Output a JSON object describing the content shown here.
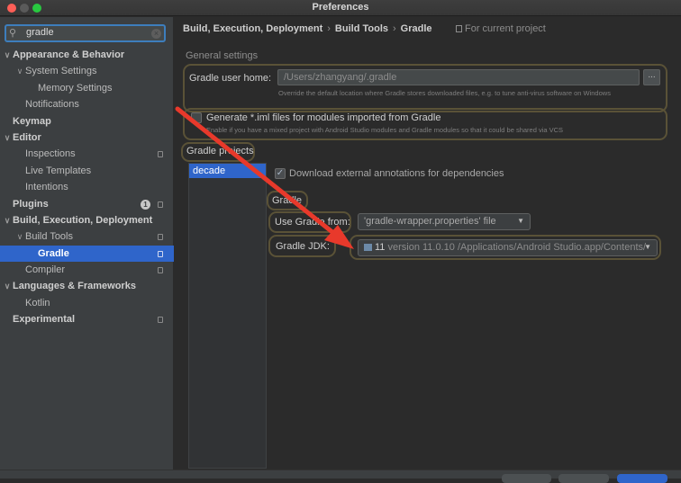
{
  "window": {
    "title": "Preferences"
  },
  "sidebar": {
    "search_value": "gradle",
    "items": [
      {
        "label": "Appearance & Behavior",
        "level": 0,
        "chevron": "down",
        "bold": true
      },
      {
        "label": "System Settings",
        "level": 1,
        "chevron": "down"
      },
      {
        "label": "Memory Settings",
        "level": 2
      },
      {
        "label": "Notifications",
        "level": 1
      },
      {
        "label": "Keymap",
        "level": 0,
        "bold": true
      },
      {
        "label": "Editor",
        "level": 0,
        "chevron": "down",
        "bold": true
      },
      {
        "label": "Inspections",
        "level": 1,
        "copy_icon": true
      },
      {
        "label": "Live Templates",
        "level": 1
      },
      {
        "label": "Intentions",
        "level": 1
      },
      {
        "label": "Plugins",
        "level": 0,
        "bold": true,
        "badge": "1",
        "copy_icon": true
      },
      {
        "label": "Build, Execution, Deployment",
        "level": 0,
        "chevron": "down",
        "bold": true
      },
      {
        "label": "Build Tools",
        "level": 1,
        "chevron": "down",
        "copy_icon": true
      },
      {
        "label": "Gradle",
        "level": 2,
        "selected": true,
        "bold": true,
        "copy_icon": true
      },
      {
        "label": "Compiler",
        "level": 1,
        "copy_icon": true
      },
      {
        "label": "Languages & Frameworks",
        "level": 0,
        "chevron": "down",
        "bold": true
      },
      {
        "label": "Kotlin",
        "level": 1
      },
      {
        "label": "Experimental",
        "level": 0,
        "bold": true,
        "copy_icon": true
      }
    ]
  },
  "breadcrumb": {
    "items": [
      "Build, Execution, Deployment",
      "Build Tools",
      "Gradle"
    ],
    "separator": "›",
    "scope_label": "For current project"
  },
  "general": {
    "section_title": "General settings",
    "user_home_label": "Gradle user home:",
    "user_home_value": "/Users/zhangyang/.gradle",
    "browse_label": "...",
    "user_home_hint": "Override the default location where Gradle stores downloaded files, e.g. to tune anti-virus software on Windows",
    "iml_checkbox_label": "Generate *.iml files for modules imported from Gradle",
    "iml_checked": false,
    "iml_hint": "Enable if you have a mixed project with Android Studio modules and Gradle modules so that it could be shared via VCS"
  },
  "projects": {
    "section_title": "Gradle projects",
    "list": [
      "decade"
    ],
    "download_annotations_label": "Download external annotations for dependencies",
    "download_annotations_checked": true,
    "gradle_section_title": "Gradle",
    "use_gradle_from_label": "Use Gradle from:",
    "use_gradle_from_value": "'gradle-wrapper.properties' file",
    "jdk_label": "Gradle JDK:",
    "jdk_value_version": "11",
    "jdk_value_detail": "version 11.0.10 /Applications/Android Studio.app/Contents/"
  },
  "colors": {
    "accent_selection": "#2f65ca",
    "annotation_arrow": "#e8392b",
    "highlight_outline": "#5a5237"
  }
}
